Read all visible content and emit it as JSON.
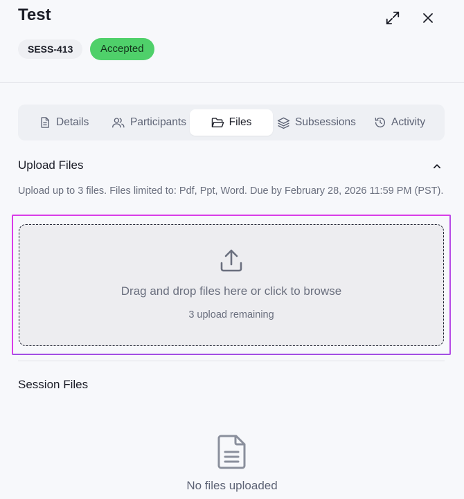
{
  "header": {
    "title": "Test",
    "session_id": "SESS-413",
    "status": "Accepted",
    "status_color": "#4fd06a",
    "expand_icon": "expand-arrows-icon",
    "close_icon": "close-icon"
  },
  "tabs": [
    {
      "label": "Details",
      "icon": "document-icon",
      "active": false
    },
    {
      "label": "Participants",
      "icon": "users-icon",
      "active": false
    },
    {
      "label": "Files",
      "icon": "folder-open-icon",
      "active": true
    },
    {
      "label": "Subsessions",
      "icon": "layers-icon",
      "active": false
    },
    {
      "label": "Activity",
      "icon": "history-icon",
      "active": false
    }
  ],
  "upload": {
    "title": "Upload Files",
    "hint": "Upload up to 3 files. Files limited to: Pdf, Ppt, Word. Due by February 28, 2026 11:59 PM (PST).",
    "dropzone_text": "Drag and drop files here or click to browse",
    "remaining_text": "3 upload remaining",
    "highlight_color": "#d93ce8"
  },
  "session_files": {
    "title": "Session Files",
    "empty_text": "No files uploaded"
  }
}
